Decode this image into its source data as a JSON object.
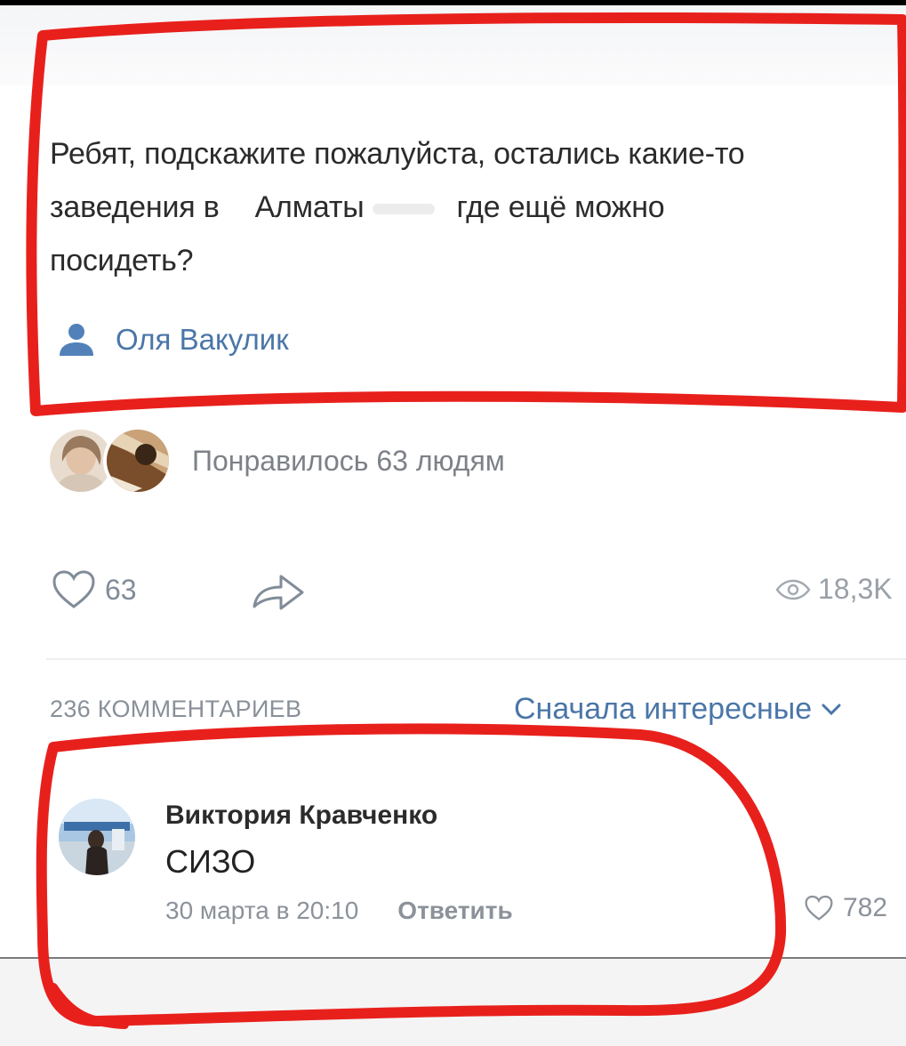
{
  "post": {
    "text_line1": "Ребят, подскажите пожалуйста, остались какие-то",
    "text_line2_start": "заведения в",
    "text_line2_city": "Алматы",
    "text_line2_end": "где ещё можно",
    "text_line3": "посидеть?",
    "author_name": "Оля Вакулик",
    "liked_text": "Понравилось 63 людям",
    "like_count": "63",
    "view_count": "18,3K"
  },
  "comments": {
    "count_label": "236 КОММЕНТАРИЕВ",
    "sort_label": "Сначала интересные"
  },
  "comment": {
    "author": "Виктория Кравченко",
    "text": "СИЗО",
    "date": "30 марта в 20:10",
    "reply_label": "Ответить",
    "like_count": "782"
  },
  "icons": {
    "author": "user-icon",
    "like": "heart-icon",
    "share": "share-icon",
    "views": "eye-icon",
    "sort": "chevron-down-icon"
  },
  "colors": {
    "link_blue": "#4a76a8",
    "annotation_red": "#e8201c",
    "muted_text": "#818c99"
  }
}
